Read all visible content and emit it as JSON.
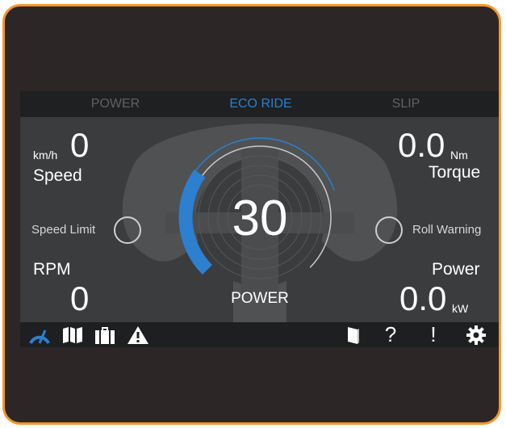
{
  "modes": [
    {
      "label": "POWER",
      "active": false
    },
    {
      "label": "ECO RIDE",
      "active": true
    },
    {
      "label": "SLIP",
      "active": false
    }
  ],
  "speed": {
    "value": "0",
    "unit": "km/h",
    "label": "Speed"
  },
  "torque": {
    "value": "0.0",
    "unit": "Nm",
    "label": "Torque"
  },
  "speed_limit": {
    "label": "Speed Limit"
  },
  "roll_warning": {
    "label": "Roll Warning"
  },
  "rpm": {
    "label": "RPM",
    "value": "0"
  },
  "power": {
    "label": "Power",
    "value": "0.0",
    "unit": "kW"
  },
  "gauge": {
    "value": "30",
    "label": "POWER",
    "fill_fraction": 0.3
  },
  "toolbar": {
    "left_icons": [
      "speedometer-icon",
      "map-icon",
      "briefcase-icon",
      "warning-icon"
    ],
    "right_icons": [
      "book-icon",
      "help-icon",
      "alert-icon",
      "settings-icon"
    ],
    "help_glyph": "?",
    "alert_glyph": "!"
  },
  "colors": {
    "frame": "#f5962b",
    "accent": "#2d7fd0",
    "screen": "#3a3c3e",
    "bar": "#1e2022"
  }
}
